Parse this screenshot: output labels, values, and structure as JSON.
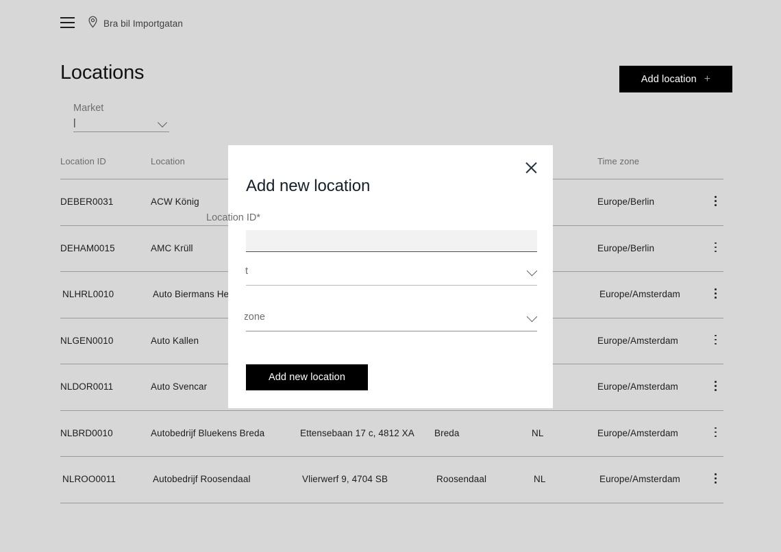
{
  "header": {
    "menu_icon": "hamburger-icon",
    "location_pin_icon": "location-pin-icon",
    "brand_label": "Bra bil Importgatan"
  },
  "page": {
    "title": "Locations",
    "add_location_label": "Add location",
    "add_location_plus": "+"
  },
  "filter": {
    "market_label": "Market",
    "market_value": "|",
    "chevron_icon": "chevron-down-icon"
  },
  "table": {
    "columns": [
      {
        "key": "id",
        "label": "Location ID"
      },
      {
        "key": "name",
        "label": "Location"
      },
      {
        "key": "address",
        "label": ""
      },
      {
        "key": "city",
        "label": ""
      },
      {
        "key": "country",
        "label": ""
      },
      {
        "key": "timezone",
        "label": "Time zone"
      }
    ],
    "rows": [
      {
        "id": "DEBER0031",
        "name": "ACW König",
        "address": "",
        "city": "",
        "country": "",
        "timezone": "Europe/Berlin"
      },
      {
        "id": "DEHAM0015",
        "name": "AMC Krüll",
        "address": "",
        "city": "",
        "country": "",
        "timezone": "Europe/Berlin"
      },
      {
        "id": "NLHRL0010",
        "name": "Auto Biermans Hee",
        "address": "",
        "city": "",
        "country": "",
        "timezone": "Europe/Amsterdam"
      },
      {
        "id": "NLGEN0010",
        "name": "Auto Kallen",
        "address": "",
        "city": "",
        "country": "",
        "timezone": "Europe/Amsterdam"
      },
      {
        "id": "NLDOR0011",
        "name": "Auto Svencar",
        "address": "",
        "city": "",
        "country": "",
        "timezone": "Europe/Amsterdam"
      },
      {
        "id": "NLBRD0010",
        "name": "Autobedrijf Bluekens Breda",
        "address": "Ettensebaan 17 c, 4812 XA",
        "city": "Breda",
        "country": "NL",
        "timezone": "Europe/Amsterdam"
      },
      {
        "id": "NLROO0011",
        "name": "Autobedrijf  Roosendaal",
        "address": "Vlierwerf 9, 4704 SB",
        "city": "Roosendaal",
        "country": "NL",
        "timezone": "Europe/Amsterdam"
      }
    ],
    "row_menu_icon": "kebab-menu-icon"
  },
  "modal": {
    "title": "Add new location",
    "close_icon": "close-icon",
    "fields": {
      "location_id": {
        "label": "Location ID*",
        "value": "",
        "placeholder": ""
      },
      "market": {
        "label": "Market*",
        "value": "",
        "chevron_icon": "chevron-down-icon"
      },
      "timezone": {
        "label": "Time zone*",
        "value": "",
        "chevron_icon": "chevron-down-icon"
      }
    },
    "submit_label": "Add new location"
  },
  "colors": {
    "page_background": "#d7d7d7",
    "modal_background": "#ffffff",
    "button_primary": "#000000",
    "button_text": "#ffffff",
    "input_fill": "#f2f2f2",
    "muted_text": "#6e6e6e",
    "rule": "#9a9a9a"
  }
}
